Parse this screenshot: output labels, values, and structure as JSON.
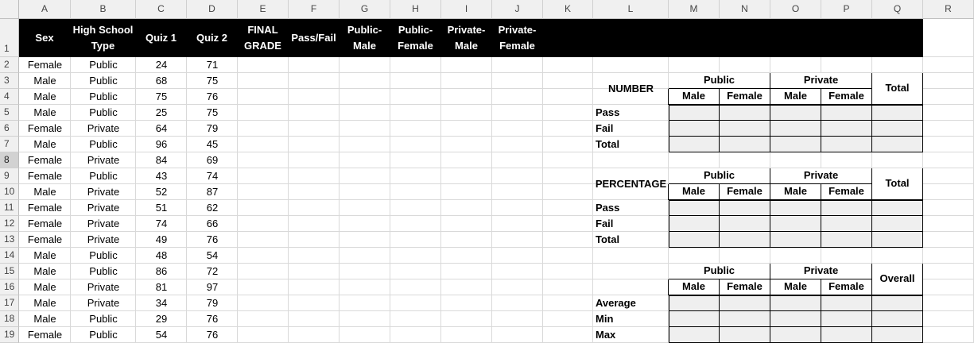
{
  "sheet": {
    "column_letters": [
      "A",
      "B",
      "C",
      "D",
      "E",
      "F",
      "G",
      "H",
      "I",
      "J",
      "K",
      "L",
      "M",
      "N",
      "O",
      "P",
      "Q",
      "R"
    ],
    "row_numbers": [
      "1",
      "2",
      "3",
      "4",
      "5",
      "6",
      "7",
      "8",
      "9",
      "10",
      "11",
      "12",
      "13",
      "14",
      "15",
      "16",
      "17",
      "18",
      "19"
    ],
    "selected_row": "8",
    "header_row": [
      "Sex",
      "High School Type",
      "Quiz 1",
      "Quiz 2",
      "FINAL GRADE",
      "Pass/Fail",
      "Public-Male",
      "Public-Female",
      "Private-Male",
      "Private-Female"
    ],
    "students": [
      [
        "Female",
        "Public",
        "24",
        "71"
      ],
      [
        "Male",
        "Public",
        "68",
        "75"
      ],
      [
        "Male",
        "Public",
        "75",
        "76"
      ],
      [
        "Male",
        "Public",
        "25",
        "75"
      ],
      [
        "Female",
        "Private",
        "64",
        "79"
      ],
      [
        "Male",
        "Public",
        "96",
        "45"
      ],
      [
        "Female",
        "Private",
        "84",
        "69"
      ],
      [
        "Female",
        "Public",
        "43",
        "74"
      ],
      [
        "Male",
        "Private",
        "52",
        "87"
      ],
      [
        "Female",
        "Private",
        "51",
        "62"
      ],
      [
        "Female",
        "Private",
        "74",
        "66"
      ],
      [
        "Female",
        "Private",
        "49",
        "76"
      ],
      [
        "Male",
        "Public",
        "48",
        "54"
      ],
      [
        "Male",
        "Public",
        "86",
        "72"
      ],
      [
        "Male",
        "Private",
        "81",
        "97"
      ],
      [
        "Male",
        "Private",
        "34",
        "79"
      ],
      [
        "Male",
        "Public",
        "29",
        "76"
      ],
      [
        "Female",
        "Public",
        "54",
        "76"
      ]
    ]
  },
  "summary": {
    "number": {
      "title": "NUMBER",
      "public": "Public",
      "private": "Private",
      "male": "Male",
      "female": "Female",
      "total_col": "Total",
      "rows": [
        "Pass",
        "Fail",
        "Total"
      ]
    },
    "percentage": {
      "title": "PERCENTAGE",
      "public": "Public",
      "private": "Private",
      "male": "Male",
      "female": "Female",
      "total_col": "Total",
      "rows": [
        "Pass",
        "Fail",
        "Total"
      ]
    },
    "stats": {
      "public": "Public",
      "private": "Private",
      "male": "Male",
      "female": "Female",
      "overall": "Overall",
      "rows": [
        "Average",
        "Min",
        "Max"
      ]
    }
  },
  "colors": {
    "header_fill": "#000000",
    "header_text": "#ffffff",
    "input_fill": "#efefef",
    "gridline": "#d9d9d9",
    "selected_row_header": "#d2d2d2"
  }
}
